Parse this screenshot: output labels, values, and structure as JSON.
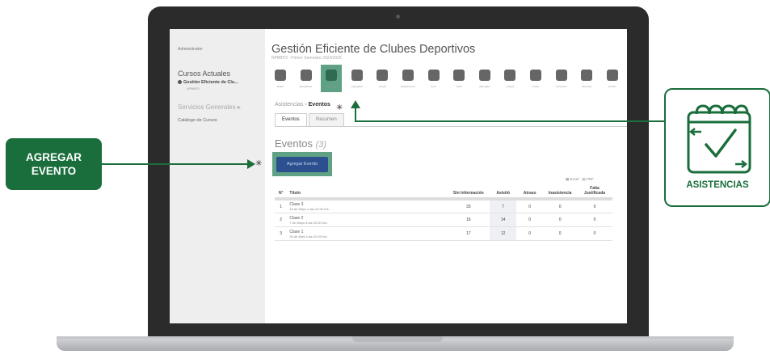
{
  "colors": {
    "accent_green": "#1a6e3c",
    "highlight_green": "#5fa184",
    "button_blue": "#2b4f8f"
  },
  "callouts": {
    "left": {
      "line1": "AGREGAR",
      "line2": "EVENTO"
    },
    "right": {
      "label": "ASISTENCIAS",
      "icon": "calendar-check-icon"
    }
  },
  "sidebar": {
    "admin": "Administrador",
    "courses_title": "Cursos Actuales",
    "course": "Gestión Eficiente de Clu...",
    "course_sub": "NPBBP3",
    "services": "Servicios Generales",
    "catalog": "Catálogo de Cursos"
  },
  "main": {
    "title": "Gestión Eficiente de Clubes Deportivos",
    "subtitle": "NPBBP3 - Primer Semestre 2024/2025",
    "toolbar": [
      {
        "icon": "edit-icon",
        "label": "Editar"
      },
      {
        "icon": "users-icon",
        "label": "Estudiantes"
      },
      {
        "icon": "attendance-icon",
        "label": "Asistencias"
      },
      {
        "icon": "calendar-icon",
        "label": "Calendario"
      },
      {
        "icon": "shapes-icon",
        "label": "Temas"
      },
      {
        "icon": "target-icon",
        "label": "Evaluaciones"
      },
      {
        "icon": "chat-icon",
        "label": "Foro"
      },
      {
        "icon": "person-icon",
        "label": "Perfil"
      },
      {
        "icon": "mail-icon",
        "label": "Mensajes"
      },
      {
        "icon": "group-icon",
        "label": "Grupos"
      },
      {
        "icon": "chart-icon",
        "label": "Notas"
      },
      {
        "icon": "book-icon",
        "label": "Contenido"
      },
      {
        "icon": "cube-icon",
        "label": "Recursos"
      },
      {
        "icon": "clock-icon",
        "label": "Horario"
      }
    ],
    "breadcrumb_root": "Asistencias",
    "breadcrumb_current": "Eventos",
    "tab_events": "Eventos",
    "tab_summary": "Resumen",
    "events_title": "Eventos",
    "events_count": "(3)",
    "add_button": "Agregar Evento",
    "export_excel": "Excel",
    "export_pdf": "PDF"
  },
  "table": {
    "headers": [
      "N°",
      "Título",
      "Sin Información",
      "Asistió",
      "Atraso",
      "Inasistencia",
      "Falta Justificada"
    ],
    "rows": [
      {
        "n": "1",
        "title": "Clase 3",
        "date": "16 de Mayo a las 20:30 hrs.",
        "sin": "33",
        "asistio": "7",
        "atraso": "0",
        "inasistencia": "0",
        "falta": "0"
      },
      {
        "n": "2",
        "title": "Clase 2",
        "date": "7 de Mayo a las 20:30 hrs.",
        "sin": "16",
        "asistio": "14",
        "atraso": "0",
        "inasistencia": "0",
        "falta": "0"
      },
      {
        "n": "3",
        "title": "Clase 1",
        "date": "30 de Abril a las 20:30 hrs.",
        "sin": "17",
        "asistio": "12",
        "atraso": "0",
        "inasistencia": "0",
        "falta": "0"
      }
    ]
  }
}
